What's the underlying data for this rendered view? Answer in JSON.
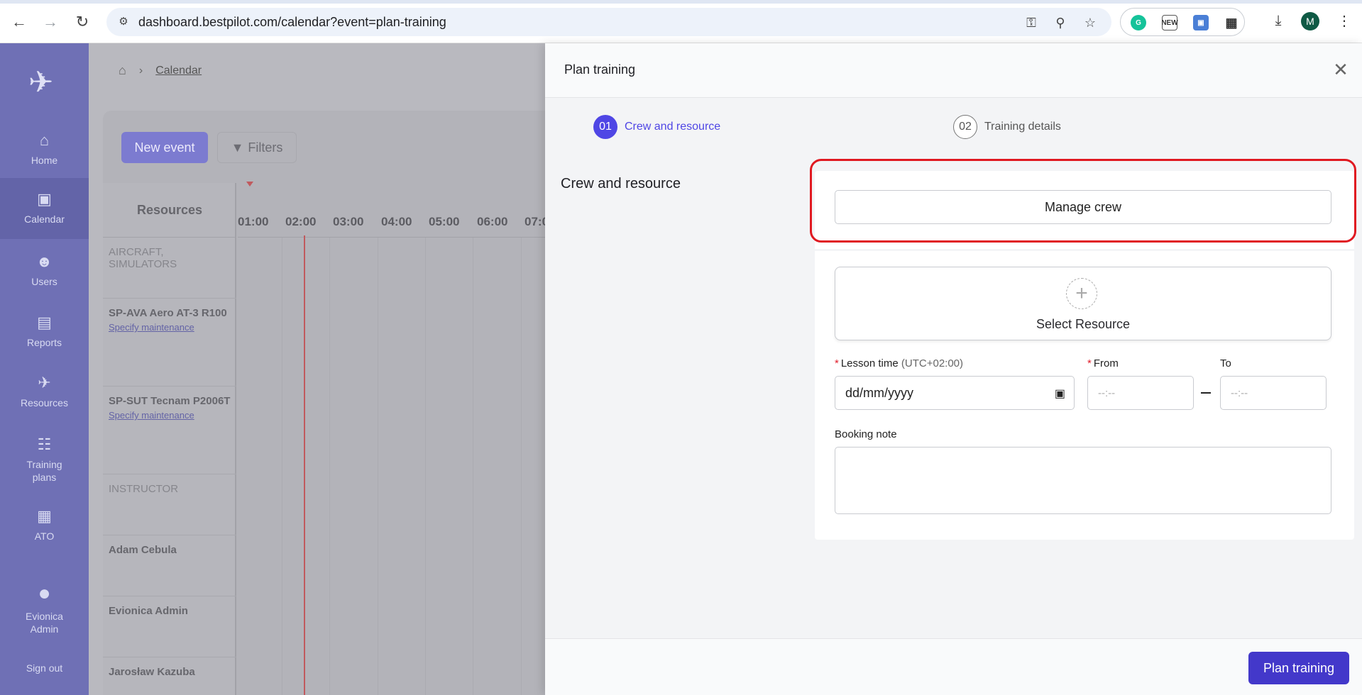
{
  "browser": {
    "url": "dashboard.bestpilot.com/calendar?event=plan-training",
    "profile_initial": "M",
    "ext_new_label": "NEW"
  },
  "sidebar": {
    "items": [
      {
        "label": "Home",
        "icon": "home-icon"
      },
      {
        "label": "Calendar",
        "icon": "calendar-icon"
      },
      {
        "label": "Users",
        "icon": "users-icon"
      },
      {
        "label": "Reports",
        "icon": "reports-icon"
      },
      {
        "label": "Resources",
        "icon": "plane-icon"
      },
      {
        "label": "Training plans",
        "icon": "book-icon"
      },
      {
        "label": "ATO",
        "icon": "building-icon"
      },
      {
        "label": "Evionica Admin",
        "icon": "user-icon"
      },
      {
        "label": "Sign out",
        "icon": ""
      }
    ]
  },
  "calendar": {
    "breadcrumb": "Calendar",
    "new_event": "New event",
    "filters": "Filters",
    "resources_header": "Resources",
    "hours": [
      "01:00",
      "02:00",
      "03:00",
      "04:00",
      "05:00",
      "06:00",
      "07:0"
    ],
    "rows": [
      {
        "category": "AIRCRAFT, SIMULATORS"
      },
      {
        "name": "SP-AVA Aero AT-3 R100",
        "link": "Specify maintenance"
      },
      {
        "name": "SP-SUT Tecnam P2006T",
        "link": "Specify maintenance"
      },
      {
        "category": "INSTRUCTOR"
      },
      {
        "name": "Adam Cebula"
      },
      {
        "name": "Evionica Admin"
      },
      {
        "name": "Jarosław Kazuba"
      }
    ]
  },
  "drawer": {
    "title": "Plan training",
    "steps": [
      {
        "number": "01",
        "label": "Crew and resource"
      },
      {
        "number": "02",
        "label": "Training details"
      }
    ],
    "section_title": "Crew and resource",
    "manage_crew": "Manage crew",
    "select_resource": "Select Resource",
    "lesson_time_label": "Lesson time",
    "lesson_time_hint": "(UTC+02:00)",
    "lesson_date_placeholder": "dd/mm/yyyy",
    "from_label": "From",
    "to_label": "To",
    "time_placeholder": "--:--",
    "booking_note_label": "Booking note",
    "submit": "Plan training"
  },
  "colors": {
    "accent": "#4f46e5",
    "sidebar": "#6f70b5",
    "highlight": "#e01921"
  }
}
